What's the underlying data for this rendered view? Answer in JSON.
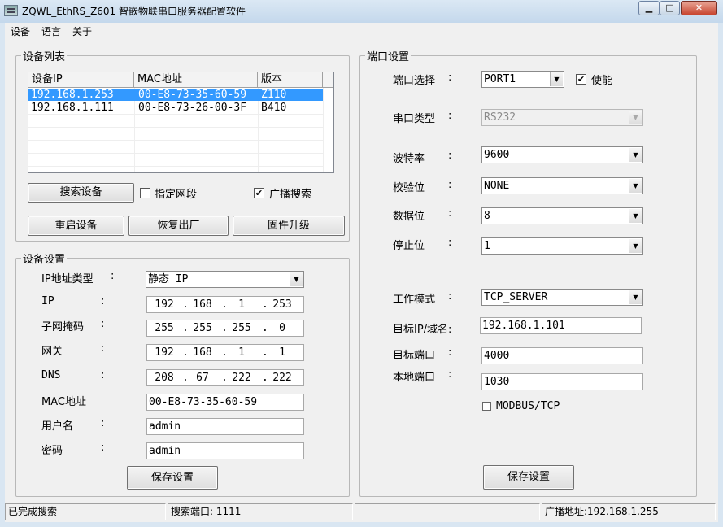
{
  "window": {
    "title": "ZQWL_EthRS_Z601  智嵌物联串口服务器配置软件",
    "min_icon": "minimize-icon",
    "max_icon": "maximize-icon",
    "close_icon": "close-icon",
    "min_glyph": "▁",
    "max_glyph": "□",
    "close_glyph": "✕"
  },
  "menu": [
    "设备",
    "语言",
    "关于"
  ],
  "device_list": {
    "title": "设备列表",
    "columns": [
      "设备IP",
      "MAC地址",
      "版本"
    ],
    "rows": [
      {
        "ip": "192.168.1.253",
        "mac": "00-E8-73-35-60-59",
        "version": "Z110",
        "selected": true
      },
      {
        "ip": "192.168.1.111",
        "mac": "00-E8-73-26-00-3F",
        "version": "B410",
        "selected": false
      }
    ],
    "search_button": "搜索设备",
    "segment_checkbox": {
      "label": "指定网段",
      "checked": false
    },
    "broadcast_checkbox": {
      "label": "广播搜索",
      "checked": true
    },
    "restart_button": "重启设备",
    "reset_button": "恢复出厂",
    "upgrade_button": "固件升级"
  },
  "device_settings": {
    "title": "设备设置",
    "ip_type_label": "IP地址类型",
    "ip_type_value": "静态 IP",
    "ip_label": "IP",
    "ip": [
      "192",
      "168",
      "1",
      "253"
    ],
    "mask_label": "子网掩码",
    "mask": [
      "255",
      "255",
      "255",
      "0"
    ],
    "gateway_label": "网关",
    "gateway": [
      "192",
      "168",
      "1",
      "1"
    ],
    "dns_label": "DNS",
    "dns": [
      "208",
      "67",
      "222",
      "222"
    ],
    "mac_label": "MAC地址",
    "mac_value": "00-E8-73-35-60-59",
    "user_label": "用户名",
    "user_value": "admin",
    "pwd_label": "密码",
    "pwd_value": "admin",
    "save_button": "保存设置",
    "colon": ":"
  },
  "port_settings": {
    "title": "端口设置",
    "port_select_label": "端口选择",
    "port_value": "PORT1",
    "enable_label": "使能",
    "enable_checked": true,
    "serial_type_label": "串口类型",
    "serial_type_value": "RS232",
    "baud_label": "波特率",
    "baud_value": "9600",
    "parity_label": "校验位",
    "parity_value": "NONE",
    "databits_label": "数据位",
    "databits_value": "8",
    "stopbits_label": "停止位",
    "stopbits_value": "1",
    "mode_label": "工作模式",
    "mode_value": "TCP_SERVER",
    "target_ip_label": "目标IP/域名:",
    "target_ip_value": "192.168.1.101",
    "target_port_label": "目标端口",
    "target_port_value": "4000",
    "local_port_label": "本地端口",
    "local_port_value": "1030",
    "modbus_label": "MODBUS/TCP",
    "modbus_checked": false,
    "save_button": "保存设置",
    "colon": ":"
  },
  "status": {
    "state": "已完成搜索",
    "search_port": "搜索端口: 1111",
    "empty": "",
    "broadcast": "广播地址:192.168.1.255"
  },
  "icons": {
    "check": "✔",
    "dropdown": "▼",
    "octet_dot": "."
  }
}
